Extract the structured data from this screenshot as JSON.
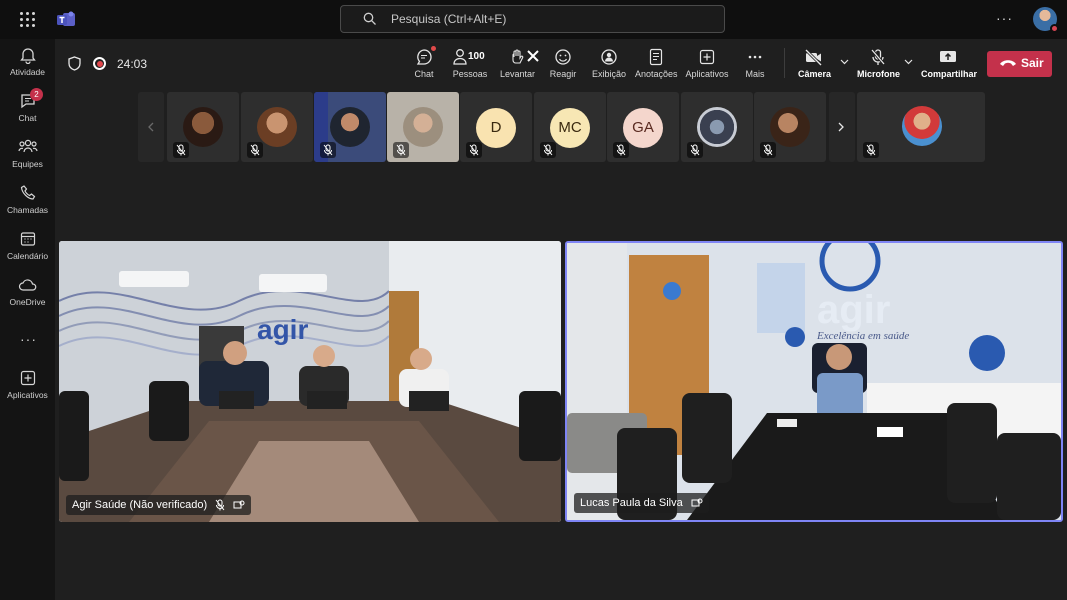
{
  "search": {
    "placeholder": "Pesquisa (Ctrl+Alt+E)"
  },
  "rail": {
    "items": [
      {
        "label": "Atividade"
      },
      {
        "label": "Chat",
        "badge": "2"
      },
      {
        "label": "Equipes"
      },
      {
        "label": "Chamadas"
      },
      {
        "label": "Calendário"
      },
      {
        "label": "OneDrive"
      },
      {
        "label": "Aplicativos"
      }
    ]
  },
  "meeting": {
    "timer": "24:03",
    "toolbar": {
      "chat": "Chat",
      "people": "Pessoas",
      "people_count": "100",
      "raise": "Levantar",
      "react": "Reagir",
      "view": "Exibição",
      "notes": "Anotações",
      "apps": "Aplicativos",
      "more": "Mais",
      "camera": "Câmera",
      "mic": "Microfone",
      "share": "Compartilhar",
      "leave": "Sair"
    },
    "thumbnails": [
      {
        "type": "photo",
        "color": "#8a5a3c"
      },
      {
        "type": "photo",
        "color": "#b07a55"
      },
      {
        "type": "photo",
        "color": "#3a4a6a"
      },
      {
        "type": "photo",
        "color": "#a89a88"
      },
      {
        "type": "initials",
        "initials": "D",
        "bg": "#f9e3b0"
      },
      {
        "type": "initials",
        "initials": "MC",
        "bg": "#f7e7b4"
      },
      {
        "type": "initials",
        "initials": "GA",
        "bg": "#f4d6cc"
      },
      {
        "type": "photo",
        "color": "#5a6a80"
      },
      {
        "type": "photo",
        "color": "#7a5040"
      }
    ],
    "videos": [
      {
        "name": "Agir Saúde (Não verificado)"
      },
      {
        "name": "Lucas Paula da Silva"
      }
    ],
    "colors": {
      "accent": "#7f85f5",
      "leave": "#c4314b",
      "badge": "#c4314b"
    }
  }
}
